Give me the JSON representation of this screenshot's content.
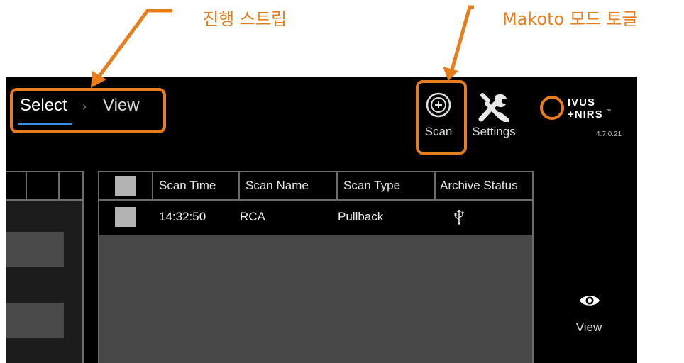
{
  "callouts": {
    "progress_strip": "진행 스트립",
    "makoto_mode_toggle": "Makoto 모드 토글"
  },
  "breadcrumb": {
    "select": "Select",
    "separator": "›",
    "view": "View"
  },
  "toolbar": {
    "scan_label": "Scan",
    "settings_label": "Settings"
  },
  "logo": {
    "line1": "IVUS",
    "line2": "+NIRS",
    "trademark": "™",
    "version": "4.7.0.21"
  },
  "table": {
    "columns": [
      "Scan Time",
      "Scan Name",
      "Scan Type",
      "Archive Status"
    ],
    "rows": [
      {
        "scan_time": "14:32:50",
        "scan_name": "RCA",
        "scan_type": "Pullback",
        "archive_status_icon": "usb-icon"
      }
    ]
  },
  "side_action": {
    "view_label": "View",
    "icon": "eye-icon"
  },
  "colors": {
    "accent_orange": "#e87d1e",
    "selected_underline": "#3a8ee6",
    "background": "#000000",
    "panel_gray": "#474747"
  }
}
